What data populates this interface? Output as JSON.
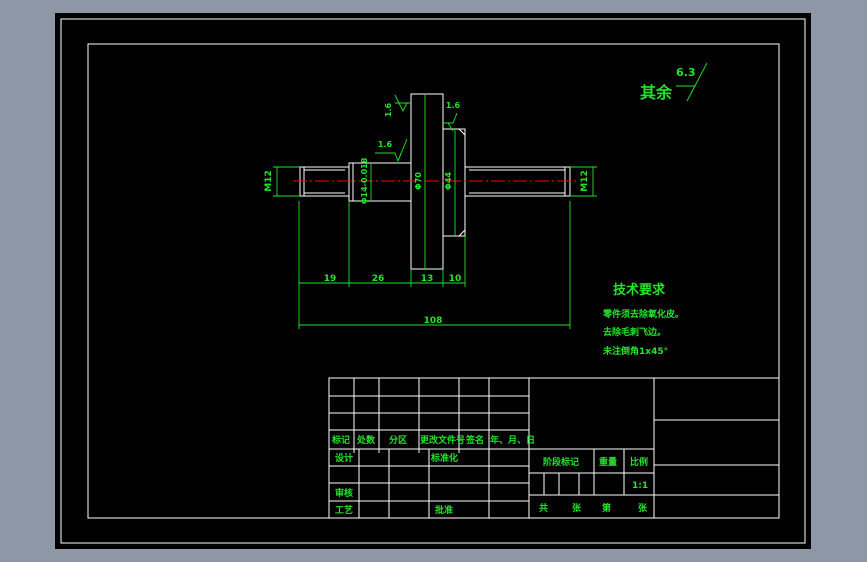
{
  "surface_finish": {
    "rest_label": "其余",
    "rest_value": "6.3",
    "marks": [
      "1.6",
      "1.6",
      "1.6"
    ]
  },
  "dimensions": {
    "left_thread": "M12",
    "right_thread": "M12",
    "neck": "Φ14-0.018",
    "flange": "Φ70",
    "shoulder": "Φ44",
    "lengths": [
      "19",
      "26",
      "13",
      "10"
    ],
    "overall": "108"
  },
  "tech_requirements": {
    "title": "技术要求",
    "items": [
      "零件须去除氧化皮。",
      "去除毛刺飞边。",
      "未注倒角1x45°"
    ]
  },
  "title_block": {
    "row_labels": [
      "标记",
      "处数",
      "分区",
      "更改文件号",
      "签名",
      "年、月、日"
    ],
    "design": "设计",
    "standardize": "标准化",
    "stage_mark": "阶段标记",
    "weight": "重量",
    "scale_label": "比例",
    "scale_value": "1:1",
    "review": "审核",
    "process": "工艺",
    "approve": "批准",
    "total": "共",
    "sheet_word": "张",
    "page_ordinal": "第",
    "page_word": "张"
  },
  "colors": {
    "background": "#000000",
    "outline": "#ffffff",
    "annotation": "#22e52a",
    "centerline": "#ff0000",
    "frame": "#8d97a6"
  }
}
